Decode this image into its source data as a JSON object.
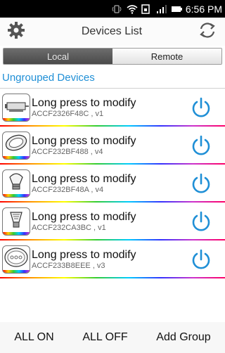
{
  "status_bar": {
    "time": "6:56 PM"
  },
  "header": {
    "title": "Devices List",
    "settings_icon": "gear-icon",
    "refresh_icon": "refresh-icon"
  },
  "tabs": [
    {
      "label": "Local",
      "active": true
    },
    {
      "label": "Remote",
      "active": false
    }
  ],
  "section": {
    "title": "Ungrouped Devices"
  },
  "devices": [
    {
      "name": "Long press to modify",
      "id": "ACCF2326F48C , v1",
      "icon": "led-strip-controller-icon"
    },
    {
      "name": "Long press to modify",
      "id": "ACCF232BF488 , v4",
      "icon": "downlight-icon"
    },
    {
      "name": "Long press to modify",
      "id": "ACCF232BF48A , v4",
      "icon": "bulb-icon"
    },
    {
      "name": "Long press to modify",
      "id": "ACCF232CA3BC , v1",
      "icon": "bulb-icon"
    },
    {
      "name": "Long press to modify",
      "id": "ACCF233B8EEE , v3",
      "icon": "ceiling-light-icon"
    }
  ],
  "bottom_bar": {
    "all_on": "ALL ON",
    "all_off": "ALL OFF",
    "add_group": "Add Group"
  },
  "colors": {
    "accent": "#1f8fd6",
    "active_tab": "#5a5a5a"
  }
}
